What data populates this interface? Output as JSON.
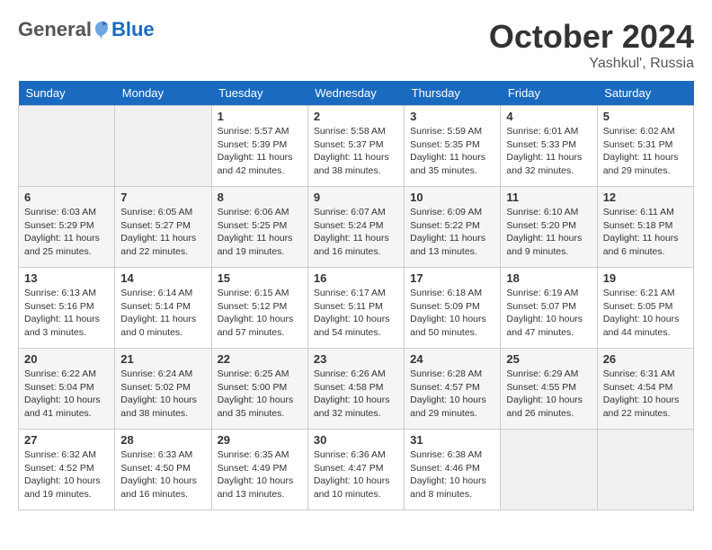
{
  "header": {
    "logo": {
      "general": "General",
      "blue": "Blue"
    },
    "title": "October 2024",
    "location": "Yashkul', Russia"
  },
  "weekdays": [
    "Sunday",
    "Monday",
    "Tuesday",
    "Wednesday",
    "Thursday",
    "Friday",
    "Saturday"
  ],
  "weeks": [
    [
      {
        "day": "",
        "info": ""
      },
      {
        "day": "",
        "info": ""
      },
      {
        "day": "1",
        "info": "Sunrise: 5:57 AM\nSunset: 5:39 PM\nDaylight: 11 hours and 42 minutes."
      },
      {
        "day": "2",
        "info": "Sunrise: 5:58 AM\nSunset: 5:37 PM\nDaylight: 11 hours and 38 minutes."
      },
      {
        "day": "3",
        "info": "Sunrise: 5:59 AM\nSunset: 5:35 PM\nDaylight: 11 hours and 35 minutes."
      },
      {
        "day": "4",
        "info": "Sunrise: 6:01 AM\nSunset: 5:33 PM\nDaylight: 11 hours and 32 minutes."
      },
      {
        "day": "5",
        "info": "Sunrise: 6:02 AM\nSunset: 5:31 PM\nDaylight: 11 hours and 29 minutes."
      }
    ],
    [
      {
        "day": "6",
        "info": "Sunrise: 6:03 AM\nSunset: 5:29 PM\nDaylight: 11 hours and 25 minutes."
      },
      {
        "day": "7",
        "info": "Sunrise: 6:05 AM\nSunset: 5:27 PM\nDaylight: 11 hours and 22 minutes."
      },
      {
        "day": "8",
        "info": "Sunrise: 6:06 AM\nSunset: 5:25 PM\nDaylight: 11 hours and 19 minutes."
      },
      {
        "day": "9",
        "info": "Sunrise: 6:07 AM\nSunset: 5:24 PM\nDaylight: 11 hours and 16 minutes."
      },
      {
        "day": "10",
        "info": "Sunrise: 6:09 AM\nSunset: 5:22 PM\nDaylight: 11 hours and 13 minutes."
      },
      {
        "day": "11",
        "info": "Sunrise: 6:10 AM\nSunset: 5:20 PM\nDaylight: 11 hours and 9 minutes."
      },
      {
        "day": "12",
        "info": "Sunrise: 6:11 AM\nSunset: 5:18 PM\nDaylight: 11 hours and 6 minutes."
      }
    ],
    [
      {
        "day": "13",
        "info": "Sunrise: 6:13 AM\nSunset: 5:16 PM\nDaylight: 11 hours and 3 minutes."
      },
      {
        "day": "14",
        "info": "Sunrise: 6:14 AM\nSunset: 5:14 PM\nDaylight: 11 hours and 0 minutes."
      },
      {
        "day": "15",
        "info": "Sunrise: 6:15 AM\nSunset: 5:12 PM\nDaylight: 10 hours and 57 minutes."
      },
      {
        "day": "16",
        "info": "Sunrise: 6:17 AM\nSunset: 5:11 PM\nDaylight: 10 hours and 54 minutes."
      },
      {
        "day": "17",
        "info": "Sunrise: 6:18 AM\nSunset: 5:09 PM\nDaylight: 10 hours and 50 minutes."
      },
      {
        "day": "18",
        "info": "Sunrise: 6:19 AM\nSunset: 5:07 PM\nDaylight: 10 hours and 47 minutes."
      },
      {
        "day": "19",
        "info": "Sunrise: 6:21 AM\nSunset: 5:05 PM\nDaylight: 10 hours and 44 minutes."
      }
    ],
    [
      {
        "day": "20",
        "info": "Sunrise: 6:22 AM\nSunset: 5:04 PM\nDaylight: 10 hours and 41 minutes."
      },
      {
        "day": "21",
        "info": "Sunrise: 6:24 AM\nSunset: 5:02 PM\nDaylight: 10 hours and 38 minutes."
      },
      {
        "day": "22",
        "info": "Sunrise: 6:25 AM\nSunset: 5:00 PM\nDaylight: 10 hours and 35 minutes."
      },
      {
        "day": "23",
        "info": "Sunrise: 6:26 AM\nSunset: 4:58 PM\nDaylight: 10 hours and 32 minutes."
      },
      {
        "day": "24",
        "info": "Sunrise: 6:28 AM\nSunset: 4:57 PM\nDaylight: 10 hours and 29 minutes."
      },
      {
        "day": "25",
        "info": "Sunrise: 6:29 AM\nSunset: 4:55 PM\nDaylight: 10 hours and 26 minutes."
      },
      {
        "day": "26",
        "info": "Sunrise: 6:31 AM\nSunset: 4:54 PM\nDaylight: 10 hours and 22 minutes."
      }
    ],
    [
      {
        "day": "27",
        "info": "Sunrise: 6:32 AM\nSunset: 4:52 PM\nDaylight: 10 hours and 19 minutes."
      },
      {
        "day": "28",
        "info": "Sunrise: 6:33 AM\nSunset: 4:50 PM\nDaylight: 10 hours and 16 minutes."
      },
      {
        "day": "29",
        "info": "Sunrise: 6:35 AM\nSunset: 4:49 PM\nDaylight: 10 hours and 13 minutes."
      },
      {
        "day": "30",
        "info": "Sunrise: 6:36 AM\nSunset: 4:47 PM\nDaylight: 10 hours and 10 minutes."
      },
      {
        "day": "31",
        "info": "Sunrise: 6:38 AM\nSunset: 4:46 PM\nDaylight: 10 hours and 8 minutes."
      },
      {
        "day": "",
        "info": ""
      },
      {
        "day": "",
        "info": ""
      }
    ]
  ]
}
